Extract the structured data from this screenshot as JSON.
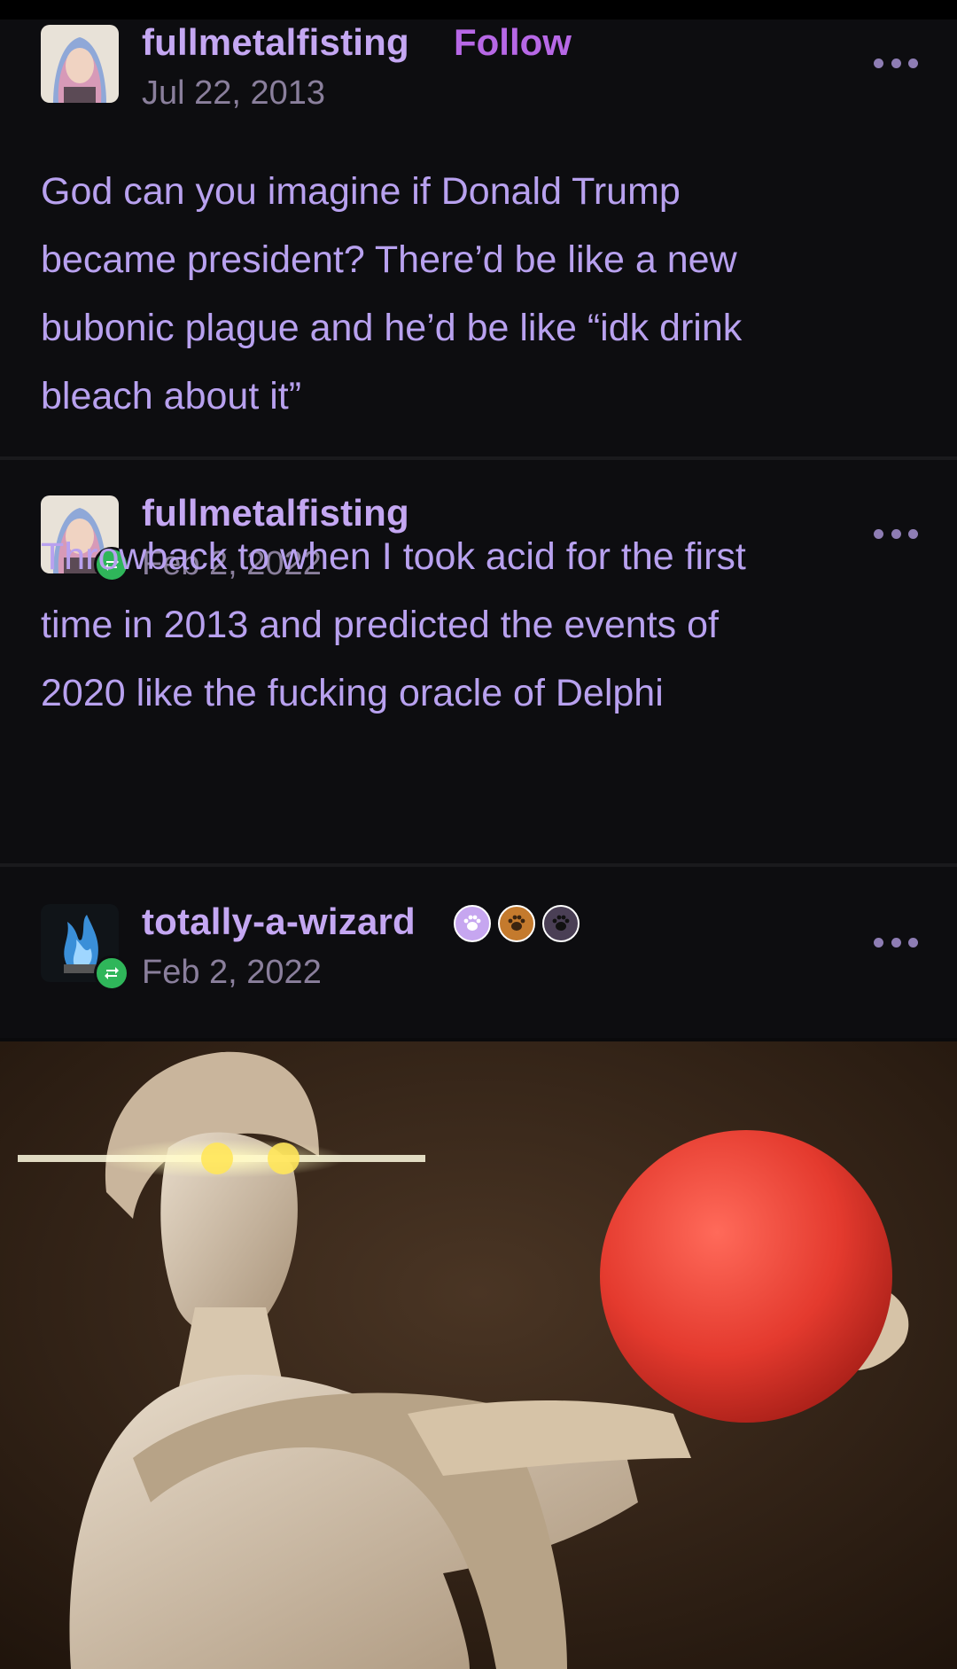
{
  "posts": [
    {
      "username": "fullmetalfisting",
      "follow_label": "Follow",
      "date": "Jul 22, 2013",
      "lines": [
        "God can you imagine if Donald Trump",
        "became president? There’d be like a new",
        "bubonic plague and he’d be like “idk drink",
        "bleach about it”"
      ]
    },
    {
      "username": "fullmetalfisting",
      "date": "Feb 2, 2022",
      "lines": [
        "Throwback to when I took acid for the first",
        "time in 2013 and predicted the events of",
        "2020 like the fucking oracle of Delphi"
      ]
    },
    {
      "username": "totally-a-wizard",
      "date": "Feb 2, 2022"
    }
  ],
  "icons": {
    "more": "more-options-icon",
    "reblog": "reblog-icon",
    "paw": "paw-badge-icon"
  },
  "colors": {
    "background": "#0d0d10",
    "username": "#c4a7f2",
    "follow": "#b768e6",
    "body_text": "#b8a1ef",
    "date": "#8a7f9c",
    "reblog_badge": "#2fb65a",
    "paw_badges": [
      "#c6a6f0",
      "#c47a2d",
      "#4a3f55"
    ]
  }
}
